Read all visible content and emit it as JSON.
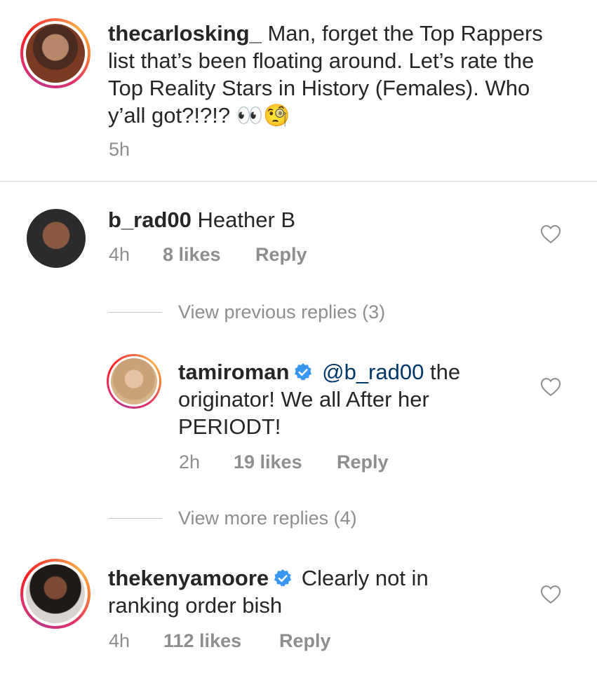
{
  "caption": {
    "username": "thecarlosking_",
    "text": "Man, forget the Top Rappers list that’s been floating around. Let’s rate the Top Reality Stars in History (Females). Who y’all got?!?!?",
    "emoji": "👀🧐",
    "time": "5h"
  },
  "comments": [
    {
      "username": "b_rad00",
      "text": "Heather B",
      "time": "4h",
      "likes": "8 likes",
      "reply": "Reply"
    },
    {
      "username": "thekenyamoore",
      "text": "Clearly not in ranking order bish",
      "time": "4h",
      "likes": "112 likes",
      "reply": "Reply"
    }
  ],
  "view_previous": "View previous replies (3)",
  "reply": {
    "username": "tamiroman",
    "mention": "@b_rad00",
    "text": "the originator! We all After her PERIODT!",
    "time": "2h",
    "likes": "19 likes",
    "reply": "Reply"
  },
  "view_more": "View more replies (4)",
  "colors": {
    "text": "#262626",
    "secondary": "#8e8e8e",
    "mention": "#00376b",
    "verified": "#3897f0"
  }
}
